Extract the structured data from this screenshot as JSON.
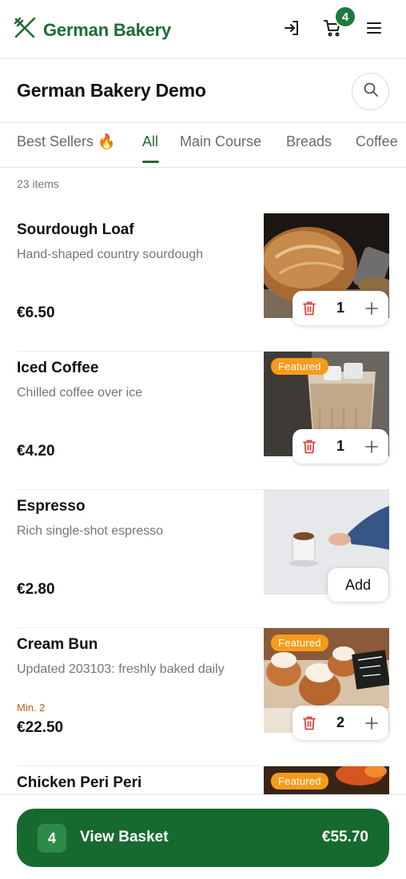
{
  "header": {
    "brand_name": "German Bakery",
    "cart_count": "4",
    "icons": {
      "logo": "fork-knife-icon",
      "login": "login-icon",
      "cart": "cart-icon",
      "menu": "menu-icon"
    },
    "accent": "#1e6b34"
  },
  "page": {
    "title": "German Bakery Demo",
    "search_icon": "search-icon"
  },
  "tabs": [
    {
      "label": "Best Sellers 🔥",
      "active": false
    },
    {
      "label": "All",
      "active": true
    },
    {
      "label": "Main Course",
      "active": false
    },
    {
      "label": "Breads",
      "active": false
    },
    {
      "label": "Coffee",
      "active": false
    }
  ],
  "item_count": "23 items",
  "featured_label": "Featured",
  "add_label": "Add",
  "items": [
    {
      "name": "Sourdough Loaf",
      "description": "Hand-shaped country sourdough",
      "min": "",
      "price": "€6.50",
      "featured": false,
      "quantity": "1"
    },
    {
      "name": "Iced Coffee",
      "description": "Chilled coffee over ice",
      "min": "",
      "price": "€4.20",
      "featured": true,
      "quantity": "1"
    },
    {
      "name": "Espresso",
      "description": "Rich single-shot espresso",
      "min": "",
      "price": "€2.80",
      "featured": false,
      "quantity": ""
    },
    {
      "name": "Cream Bun",
      "description": "Updated 203103: freshly baked daily",
      "min": "Min. 2",
      "price": "€22.50",
      "featured": true,
      "quantity": "2"
    },
    {
      "name": "Chicken Peri Peri",
      "description": "",
      "min": "",
      "price": "",
      "featured": true,
      "quantity": ""
    }
  ],
  "basket": {
    "count": "4",
    "label": "View Basket",
    "total": "€55.70",
    "color": "#166a2f"
  }
}
